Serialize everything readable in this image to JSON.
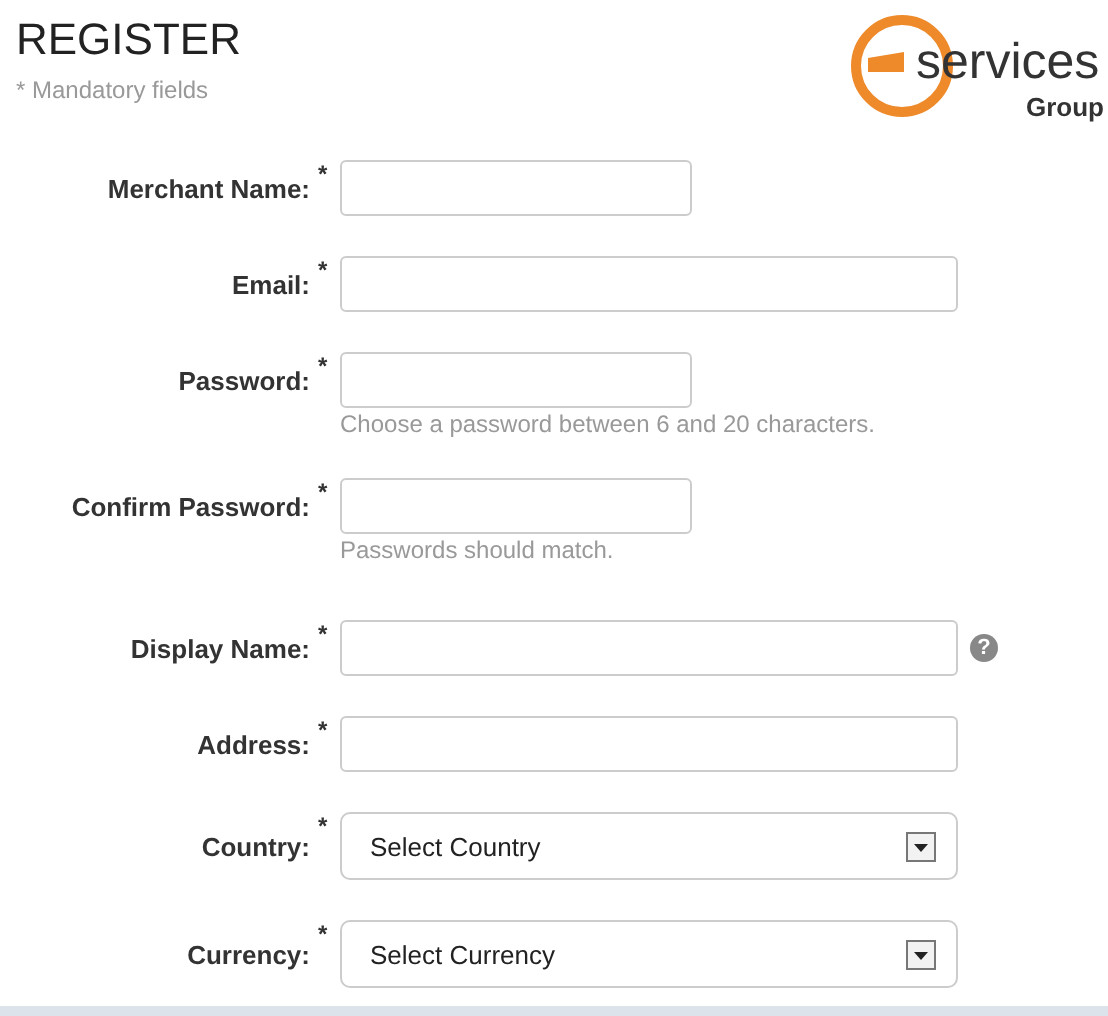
{
  "title": "REGISTER",
  "subtitle": "* Mandatory fields",
  "logo": {
    "word": "services",
    "sub": "Group"
  },
  "sections": [
    [
      {
        "label": "Merchant Name:",
        "mark": "*",
        "kind": "text",
        "wide": false
      },
      {
        "label": "Email:",
        "mark": "*",
        "kind": "text",
        "wide": true
      },
      {
        "label": "Password:",
        "mark": "*",
        "kind": "password",
        "wide": false,
        "hint": "Choose a password between 6 and 20 characters."
      },
      {
        "label": "Confirm Password:",
        "mark": "*",
        "kind": "password",
        "wide": false,
        "hint": "Passwords should match."
      }
    ],
    [
      {
        "label": "Display Name:",
        "mark": "*",
        "kind": "text",
        "wide": true,
        "help": "?"
      },
      {
        "label": "Address:",
        "mark": "*",
        "kind": "text",
        "wide": true
      },
      {
        "label": "Country:",
        "mark": "*",
        "kind": "select",
        "wide": true,
        "value": "Select Country"
      },
      {
        "label": "Currency:",
        "mark": "*",
        "kind": "select",
        "wide": true,
        "value": "Select Currency"
      }
    ]
  ]
}
